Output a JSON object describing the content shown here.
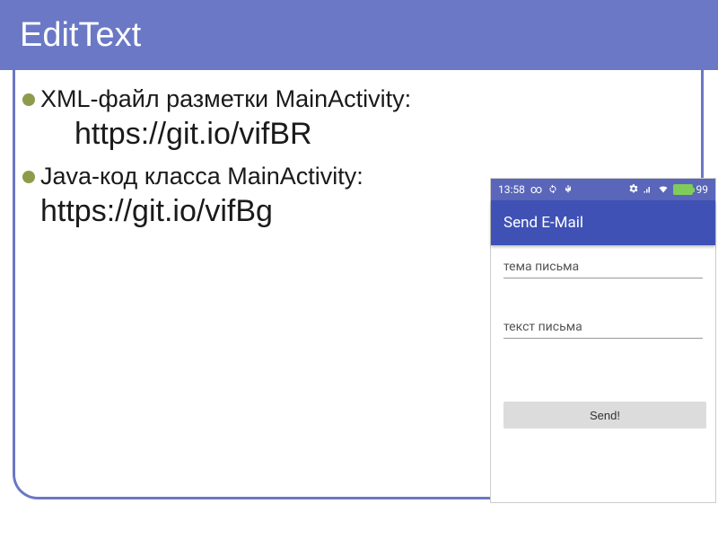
{
  "header": {
    "title": "EditText"
  },
  "bullets": [
    {
      "text": "XML-файл разметки MainActivity:",
      "link": "https://git.io/vifBR"
    },
    {
      "text": "Java-код класса MainActivity:",
      "link": "https://git.io/vifBg"
    }
  ],
  "phone": {
    "status": {
      "time": "13:58",
      "battery_pct": "99"
    },
    "appbar_title": "Send E-Mail",
    "field_subject": "тема письма",
    "field_body": "текст письма",
    "send_label": "Send!"
  }
}
